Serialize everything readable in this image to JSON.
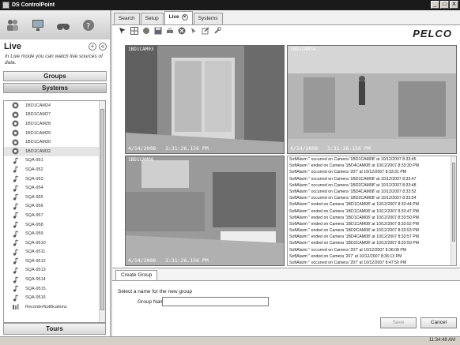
{
  "window": {
    "title": "DS ControlPoint"
  },
  "window_buttons": [
    "_",
    "□",
    "X"
  ],
  "left": {
    "section_title": "Live",
    "add_symbol": "+",
    "collapse_symbol": "«",
    "description": "In Live mode you can watch live sources of data.",
    "groups_label": "Groups",
    "systems_label": "Systems",
    "tours_label": "Tours",
    "devices": [
      {
        "label": "1BD1CAM24",
        "type": "camera"
      },
      {
        "label": "1BD1CAM27",
        "type": "camera"
      },
      {
        "label": "1BD1CAM28",
        "type": "camera"
      },
      {
        "label": "1BD1CAM29",
        "type": "camera"
      },
      {
        "label": "1BD1CAM30",
        "type": "camera"
      },
      {
        "label": "1BD1CAM32",
        "type": "camera"
      },
      {
        "label": "SQA-951",
        "type": "audio"
      },
      {
        "label": "SQA-952",
        "type": "audio"
      },
      {
        "label": "SQA-953",
        "type": "audio"
      },
      {
        "label": "SQA-954",
        "type": "audio"
      },
      {
        "label": "SQA-955",
        "type": "audio"
      },
      {
        "label": "SQA-956",
        "type": "audio"
      },
      {
        "label": "SQA-957",
        "type": "audio"
      },
      {
        "label": "SQA-958",
        "type": "audio"
      },
      {
        "label": "SQA-959",
        "type": "audio"
      },
      {
        "label": "SQA-9510",
        "type": "audio"
      },
      {
        "label": "SQA-9511",
        "type": "audio"
      },
      {
        "label": "SQA-9512",
        "type": "audio"
      },
      {
        "label": "SQA-9513",
        "type": "audio"
      },
      {
        "label": "SQA-9514",
        "type": "audio"
      },
      {
        "label": "SQA-9515",
        "type": "audio"
      },
      {
        "label": "SQA-9516",
        "type": "audio"
      },
      {
        "label": "RecorderNotifications",
        "type": "recorder"
      }
    ]
  },
  "tabs": [
    {
      "label": "Search"
    },
    {
      "label": "Setup"
    },
    {
      "label": "Live",
      "close": "×"
    },
    {
      "label": "Systems"
    }
  ],
  "brand": "PELCO",
  "cameras": [
    {
      "label": "1BD1CAM03",
      "timestamp": "4/14/2008   3:31:26.156 PM"
    },
    {
      "label": "1BD1CAM34",
      "timestamp": "4/14/2008   3:31:26.156 PM"
    },
    {
      "label": "1BD1CAM06",
      "timestamp": "4/14/2008   3:31:26.156 PM"
    }
  ],
  "log_lines": [
    "SoftAlarm '' occurred on Camera '1BD1CAM08' at 10/12/2007 8:33:45",
    "SoftAlarm '' ended on Camera '1BD4CAM08' at 10/12/2007 8:33:30 PM",
    "SoftAlarm '' occurred on Camera '207' at 10/12/2007 8:33:31 PM",
    "SoftAlarm '' occurred on Camera '1BD1CAM08' at 10/12/2007 8:33:47",
    "SoftAlarm '' occurred on Camera '1BD2CAM08' at 10/12/2007 8:33:48",
    "SoftAlarm '' occurred on Camera '1BD4CAM08' at 10/12/2007 8:33:52",
    "SoftAlarm '' occurred on Camera '1BD2CAM08' at 10/12/2007 8:33:54",
    "SoftAlarm '' ended on Camera '1BD1CAM08' at 10/12/2007 8:33:44 PM",
    "SoftAlarm '' ended on Camera '1BD1CAM08' at 10/12/2007 8:33:47 PM",
    "SoftAlarm '' ended on Camera '1BD1CAM08' at 10/12/2007 8:33:50 PM",
    "SoftAlarm '' ended on Camera '1BD1CAM08' at 10/12/2007 8:33:52 PM",
    "SoftAlarm '' ended on Camera '1BD2CAM08' at 10/12/2007 8:33:53 PM",
    "SoftAlarm '' ended on Camera '1BD4CAM08' at 10/12/2007 8:33:57 PM",
    "SoftAlarm '' ended on Camera '1BD2CAM08' at 10/12/2007 8:33:59 PM",
    "SoftAlarm '' occurred on Camera '207' at 10/12/2007 8:36:08 PM",
    "SoftAlarm '' ended on Camera '207' at 10/12/2007 8:36:13 PM",
    "SoftAlarm '' occurred on Camera '207' at 10/12/2007 8:47:50 PM"
  ],
  "group_form": {
    "tab_label": "Create Group",
    "prompt": "Select a name for the new group",
    "name_label": "Group Name:",
    "name_value": "",
    "save_label": "Save",
    "cancel_label": "Cancel"
  },
  "status": {
    "time": "11:34:48 AM"
  }
}
